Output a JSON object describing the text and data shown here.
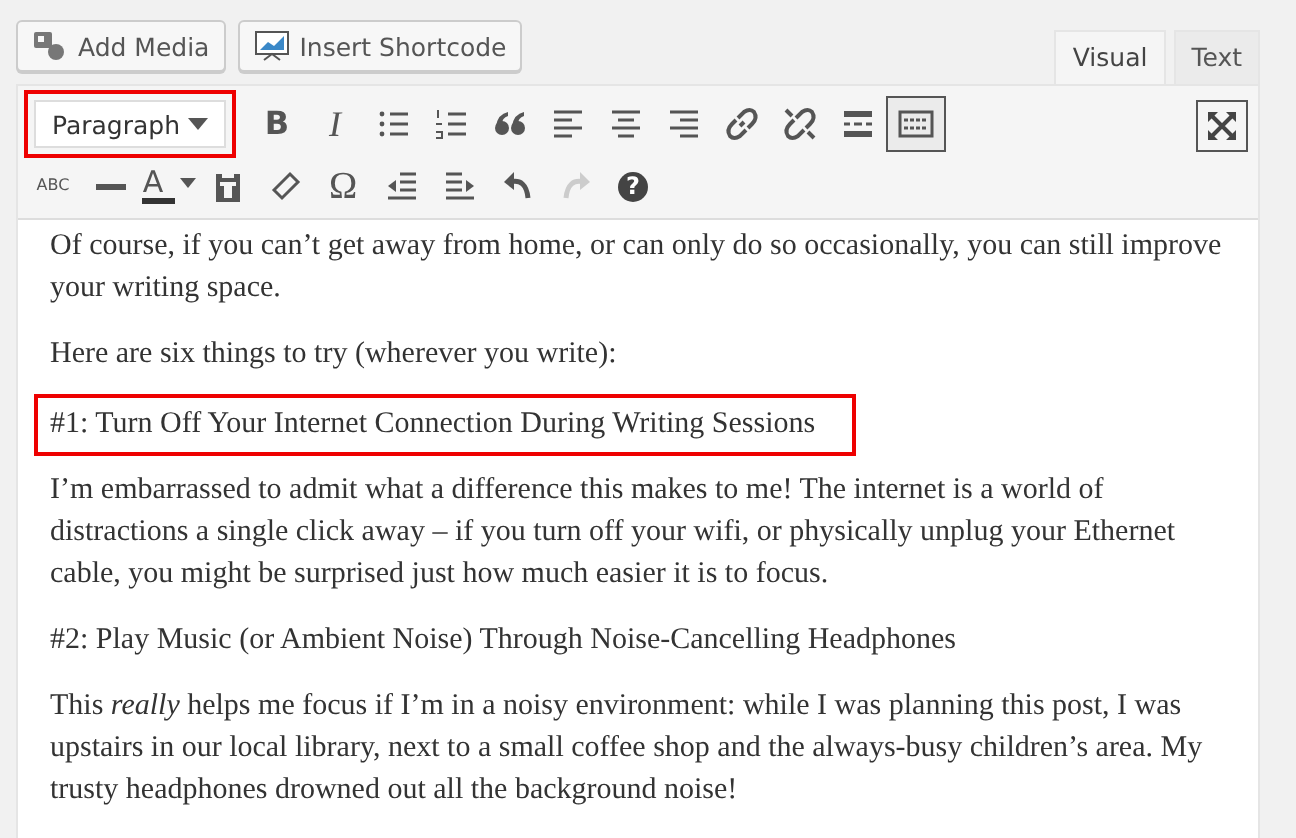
{
  "media_buttons": [
    {
      "kind": "media",
      "label": "Add Media"
    },
    {
      "kind": "shortcode",
      "label": "Insert Shortcode"
    }
  ],
  "tabs": [
    {
      "label": "Visual",
      "selected": true
    },
    {
      "label": "Text",
      "selected": false
    }
  ],
  "format_select": {
    "value": "Paragraph",
    "highlighted": true
  },
  "toolbar_rows": [
    [
      {
        "kind": "bold",
        "glyph": "B",
        "pressed": false,
        "disabled": false
      },
      {
        "kind": "italic",
        "glyph": "I",
        "pressed": false,
        "disabled": false
      },
      {
        "kind": "bullist",
        "pressed": false,
        "disabled": false
      },
      {
        "kind": "numlist",
        "pressed": false,
        "disabled": false
      },
      {
        "kind": "quote",
        "pressed": false,
        "disabled": false
      },
      {
        "kind": "alignleft",
        "pressed": false,
        "disabled": false
      },
      {
        "kind": "aligncenter",
        "pressed": false,
        "disabled": false
      },
      {
        "kind": "alignright",
        "pressed": false,
        "disabled": false
      },
      {
        "kind": "link",
        "pressed": false,
        "disabled": false
      },
      {
        "kind": "unlink",
        "pressed": false,
        "disabled": false
      },
      {
        "kind": "more",
        "pressed": false,
        "disabled": false
      },
      {
        "kind": "toggle",
        "pressed": true,
        "disabled": false
      }
    ],
    [
      {
        "kind": "strike",
        "glyph": "ABC",
        "pressed": false,
        "disabled": false
      },
      {
        "kind": "hr",
        "pressed": false,
        "disabled": false
      },
      {
        "kind": "textcolor",
        "glyph": "A",
        "pressed": false,
        "disabled": false
      },
      {
        "kind": "pastetext",
        "pressed": false,
        "disabled": false
      },
      {
        "kind": "eraser",
        "pressed": false,
        "disabled": false
      },
      {
        "kind": "charmap",
        "glyph": "Ω",
        "pressed": false,
        "disabled": false
      },
      {
        "kind": "outdent",
        "pressed": false,
        "disabled": false
      },
      {
        "kind": "indent",
        "pressed": false,
        "disabled": false
      },
      {
        "kind": "undo",
        "pressed": false,
        "disabled": false
      },
      {
        "kind": "redo",
        "pressed": false,
        "disabled": true
      },
      {
        "kind": "help",
        "glyph": "?",
        "pressed": false,
        "disabled": false
      }
    ]
  ],
  "paragraphs": [
    {
      "text": "Of course, if you can’t get away from home, or can only do so occasionally, you can still improve your writing space.",
      "highlighted": false
    },
    {
      "text": "Here are six things to try (wherever you write):",
      "highlighted": false
    },
    {
      "text": "#1: Turn Off Your Internet Connection During Writing Sessions",
      "highlighted": true
    },
    {
      "text": "I’m embarrassed to admit what a difference this makes to me! The internet is a world of distractions a single click away – if you turn off your wifi, or physically unplug your Ethernet cable, you might be surprised just how much easier it is to focus.",
      "highlighted": false
    },
    {
      "text": "#2: Play Music (or Ambient Noise) Through Noise-Cancelling Headphones",
      "highlighted": false
    },
    {
      "text": "This *really* helps me focus if I’m in a noisy environment: while I was planning this post, I was upstairs in our local library, next to a small coffee shop and the always-busy children’s area. My trusty headphones drowned out all the background noise!",
      "highlighted": false
    }
  ]
}
